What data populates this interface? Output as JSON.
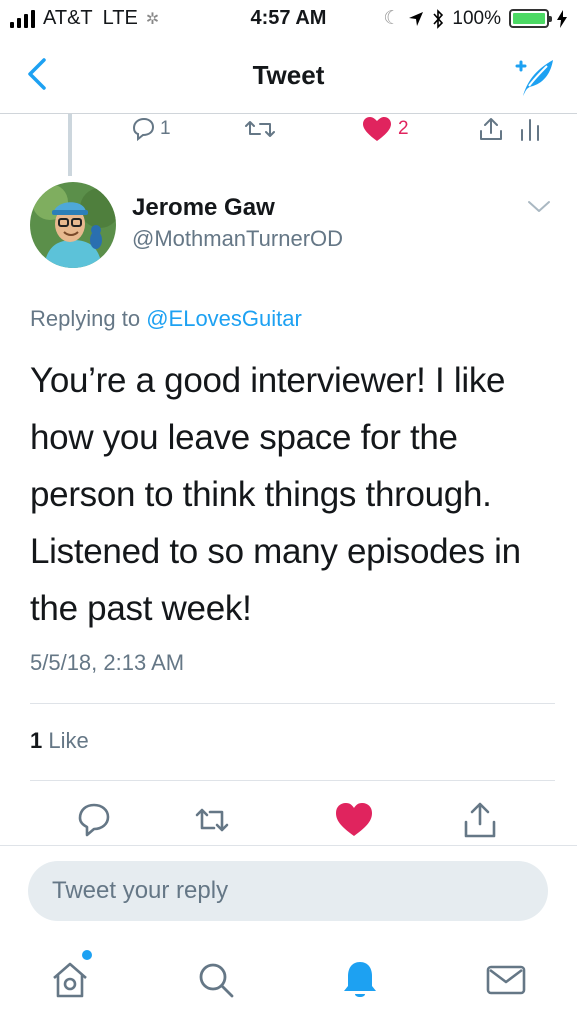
{
  "status_bar": {
    "carrier": "AT&T",
    "network": "LTE",
    "time": "4:57 AM",
    "battery": "100%"
  },
  "nav": {
    "title": "Tweet",
    "back_icon": "chevron-left-icon",
    "compose_icon": "compose-tweet-icon"
  },
  "prev_tweet_actions": {
    "reply_count": "1",
    "like_count": "2"
  },
  "tweet": {
    "author_name": "Jerome Gaw",
    "author_handle": "@MothmanTurnerOD",
    "replying_prefix": "Replying to",
    "replying_to": "@ELovesGuitar",
    "text": "You’re a good interviewer! I like how you leave space for the person to think things through. Listened to so many episodes in the past week!",
    "timestamp": "5/5/18, 2:13 AM",
    "likes_count": "1",
    "likes_label": "Like"
  },
  "reply": {
    "placeholder": "Tweet your reply"
  },
  "colors": {
    "accent": "#1da1f2",
    "like": "#e0245e",
    "secondary_text": "#657786"
  }
}
